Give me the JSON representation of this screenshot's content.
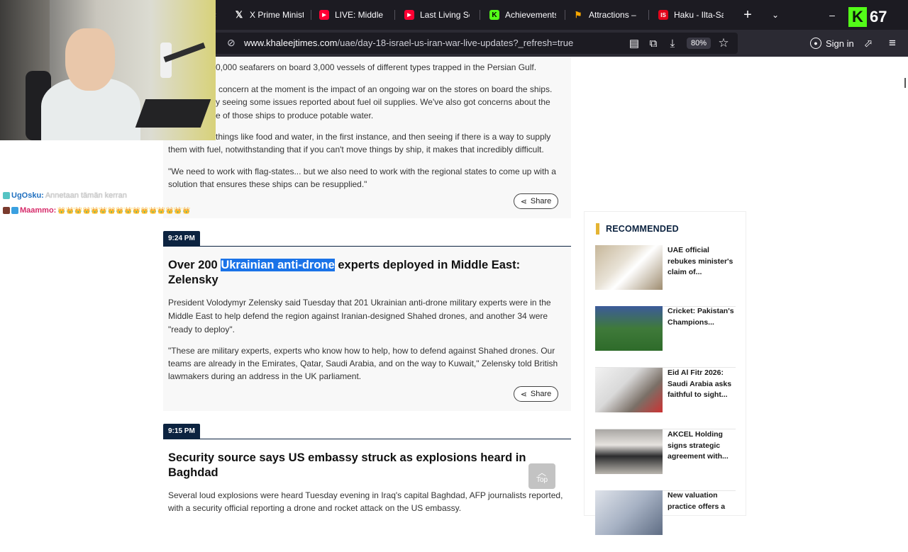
{
  "browser": {
    "tabs": [
      {
        "label": "X Prime Minister",
        "icon": "x-logo-icon",
        "color": "#000000"
      },
      {
        "label": "LIVE: Middle Ea",
        "icon": "youtube-icon",
        "color": "#ff0033"
      },
      {
        "label": "Last Living Soul",
        "icon": "youtube-icon",
        "color": "#ff0033"
      },
      {
        "label": "Achievements -",
        "icon": "kick-icon",
        "color": "#53fc18"
      },
      {
        "label": "Attractions – K",
        "icon": "flag-icon",
        "color": "#f7a600"
      },
      {
        "label": "Haku - Ilta-San",
        "icon": "is-icon",
        "color": "#e3051b"
      }
    ],
    "new_tab": "+",
    "kick_count": "67",
    "url_domain": "www.khaleejtimes.com",
    "url_path": "/uae/day-18-israel-us-iran-war-live-updates?_refresh=true",
    "zoom": "80%",
    "sign_in": "Sign in"
  },
  "chat": [
    {
      "user": "UgOsku:",
      "message": "Annetaan tämän kerran"
    },
    {
      "user": "Maammo:",
      "message": "👑 👑 👑 👑 👑 👑 👑 👑 👑 👑 👑 👑 👑 👑 👑 👑"
    }
  ],
  "article": {
    "prev_p1": "0,000 seafarers on board 3,000 vessels of different types trapped in the Persian Gulf.",
    "prev_p2a": "concern at the moment is the impact of an ongoing war on the stores on board the ships.",
    "prev_p2b": "y seeing some issues reported about fuel oil supplies. We've also got concerns about the",
    "prev_p2c": "e of those ships to produce potable water.",
    "prev_p3a": "things like food and water, in the first instance, and then seeing if there is a way to supply",
    "prev_p3b": "them with fuel, notwithstanding that if you can't move things by ship, it makes that incredibly difficult.",
    "prev_p4a": "\"We need to work with flag-states... but we also need to work with the regional states to come up with a",
    "prev_p4b": "solution that ensures these ships can be resupplied.\"",
    "share": "Share",
    "entry1": {
      "time": "9:24 PM",
      "headline_pre": "Over 200 ",
      "headline_sel": "Ukrainian anti-drone",
      "headline_post": " experts deployed in Middle East:",
      "headline_line2": "Zelensky",
      "p1a": "President Volodymyr Zelensky said Tuesday that 201 Ukrainian anti-drone military experts were in the",
      "p1b": "Middle East to help defend the region against Iranian-designed Shahed drones, and another 34 were",
      "p1c": "\"ready to deploy\".",
      "p2a": "\"These are military experts, experts who know how to help, how to defend against Shahed drones. Our",
      "p2b": "teams are already in the Emirates, Qatar, Saudi Arabia, and on the way to Kuwait,\" Zelensky told British",
      "p2c": "lawmakers during an address in the UK parliament."
    },
    "entry2": {
      "time": "9:15 PM",
      "headline_line1": "Security source says US embassy struck as explosions heard in",
      "headline_line2": "Baghdad",
      "p1a": "Several loud explosions were heard Tuesday evening in Iraq's capital Baghdad, AFP journalists reported,",
      "p1b": "with a security official reporting a drone and rocket attack on the US embassy."
    },
    "top_label": "Top"
  },
  "recommended": {
    "title": "RECOMMENDED",
    "items": [
      {
        "text": "UAE official rebukes minister's claim of..."
      },
      {
        "text": "Cricket: Pakistan's Champions..."
      },
      {
        "text": "Eid Al Fitr 2026: Saudi Arabia asks faithful to sight..."
      },
      {
        "text": "AKCEL Holding signs strategic agreement with..."
      },
      {
        "text": "New valuation practice offers a"
      }
    ]
  }
}
